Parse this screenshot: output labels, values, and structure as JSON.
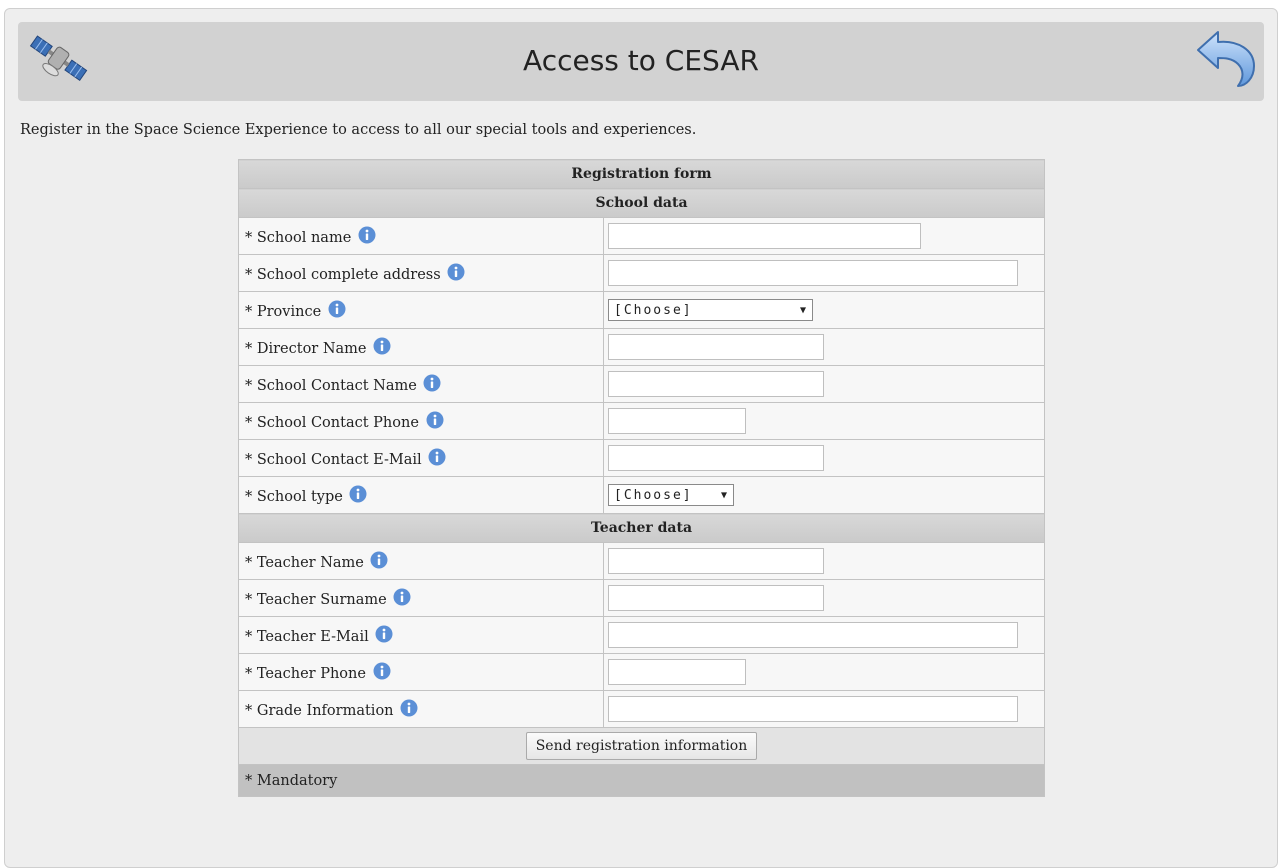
{
  "header": {
    "title": "Access to CESAR",
    "left_icon": "satellite-icon",
    "right_icon": "back-arrow-icon"
  },
  "intro_text": "Register in the Space Science Experience to access to all our special tools and experiences.",
  "form": {
    "title": "Registration form",
    "school_section": "School data",
    "teacher_section": "Teacher data",
    "required_marker": "*",
    "school_fields": [
      {
        "label": "School name",
        "type": "text",
        "value": ""
      },
      {
        "label": "School complete address",
        "type": "text",
        "value": ""
      },
      {
        "label": "Province",
        "type": "select",
        "value": "[Choose]"
      },
      {
        "label": "Director Name",
        "type": "text",
        "value": ""
      },
      {
        "label": "School Contact Name",
        "type": "text",
        "value": ""
      },
      {
        "label": "School Contact Phone",
        "type": "text",
        "value": ""
      },
      {
        "label": "School Contact E-Mail",
        "type": "text",
        "value": ""
      },
      {
        "label": "School type",
        "type": "select",
        "value": "[Choose]"
      }
    ],
    "teacher_fields": [
      {
        "label": "Teacher Name",
        "type": "text",
        "value": ""
      },
      {
        "label": "Teacher Surname",
        "type": "text",
        "value": ""
      },
      {
        "label": "Teacher E-Mail",
        "type": "text",
        "value": ""
      },
      {
        "label": "Teacher Phone",
        "type": "text",
        "value": ""
      },
      {
        "label": "Grade Information",
        "type": "text",
        "value": ""
      }
    ],
    "submit_label": "Send registration information",
    "footer_note": "* Mandatory"
  },
  "colors": {
    "panel_bg": "#eeeeee",
    "header_bg": "#d2d2d2",
    "info_icon": "#5b8fd6",
    "footer_bg": "#c1c1c1"
  }
}
